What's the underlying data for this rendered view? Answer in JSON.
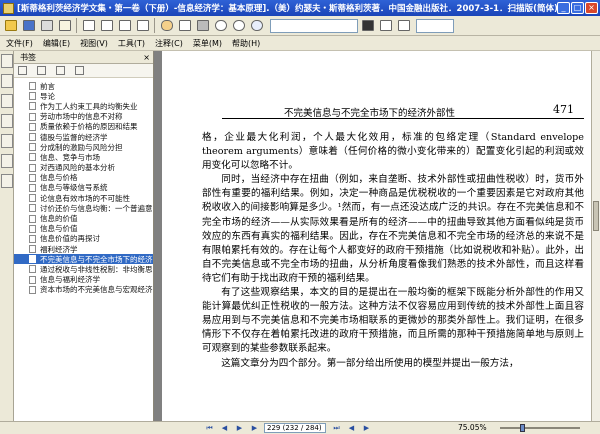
{
  "window": {
    "title": "[斯蒂格利茨经济学文集・第一卷（下册）-信息经济学：基本原理].（美）约瑟夫・斯蒂格利茨著．中国金融出版社．2007-3-1．扫描版(简体).pd..."
  },
  "menubar": {
    "items": [
      "文件(F)",
      "编辑(E)",
      "视图(V)",
      "工具(T)",
      "注释(C)",
      "菜单(M)",
      "帮助(H)"
    ]
  },
  "toolbar": {
    "zoom_value": ""
  },
  "sidebar": {
    "header": "书签",
    "close": "×",
    "bookmarks": [
      "前言",
      "导论",
      "作为工人约束工具的均衡失业",
      "劳动市场中的信息不对称",
      "质量依赖于价格的原因和结果",
      "德股与监督的经济学",
      "分成制的激励与风险分担",
      "信息、竞争与市场",
      "对西通风险的基本分析",
      "信息与价格",
      "信息与等级信号系统",
      "论信息有效市场的不可能性",
      "讨价还价与信息均衡：一个普遍意…",
      "信息的价值",
      "信息与价值",
      "信息价值的再探讨",
      "福利经济学",
      "不完美信息与不完全市场下的经济…",
      "通过税收与非线性税制：非均衡思…",
      "信息与福利经济学",
      "资本市场的不完美信息与宏观经济…"
    ],
    "selected_index": 17
  },
  "document": {
    "running_head": "不完美信息与不完全市场下的经济外部性",
    "page_number": "471",
    "paragraphs": [
      "格，企业最大化利润，个人最大化效用，标准的包络定理（Standard envelope theorem arguments）意味着（任何价格的微小变化带来的）配置变化引起的利润或效用变化可以忽略不计。",
      "同时，当经济中存在扭曲（例如，来自垄断、技术外部性或扭曲性税收）时，货币外部性有重要的福利结果。例如，决定一种商品是优税税收的一个重要因素是它对政府其他税收收入的间接影响算是多少。¹然而，有一点还没达成广泛的共识。存在不完美信息和不完全市场的经济——从实际效果看是所有的经济——中的扭曲导致其他方面看似纯是货币效应的东西有真实的福利结果。因此，存在不完美信息和不完全市场的经济总的来说不是有限帕累托有效的。存在让每个人都变好的政府干预措施（比如说税收和补贴）。此外，出自不完美信息或不完全市场的扭曲，从分析角度看像我们熟悉的技术外部性，而且这样看待它们有助于找出政府干预的福利结果。",
      "有了这些观察结果，本文的目的是提出在一般均衡的框架下既能分析外部性的作用又能计算最优纠正性税收的一般方法。这种方法不仅容易应用到传统的技术外部性上面且容易应用到与不完美信息和不完美市场相联系的更微妙的那类外部性上。我们证明，在很多情形下不仅存在着帕累托改进的政府干预措施，而且所需的那种干预措施简单地与原则上可观察到的某些参数联系起来。",
      "这篇文章分为四个部分。第一部分给出所使用的模型并提出一般方法，"
    ]
  },
  "status": {
    "page_indicator": "229 (232 / 284)",
    "zoom": "75.05%"
  }
}
